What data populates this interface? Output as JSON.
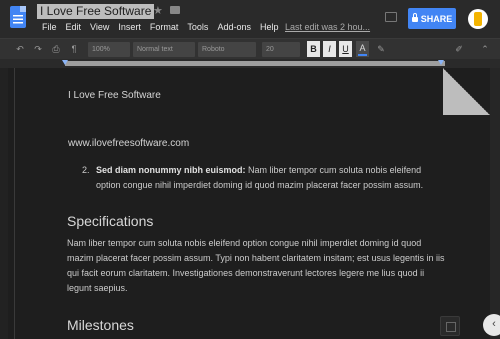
{
  "header": {
    "doc_title": "I Love Free Software",
    "menu": [
      "File",
      "Edit",
      "View",
      "Insert",
      "Format",
      "Tools",
      "Add-ons",
      "Help"
    ],
    "last_edit": "Last edit was 2 hou...",
    "share_label": "SHARE"
  },
  "toolbar": {
    "zoom": "100%",
    "style": "Normal text",
    "font": "Roboto",
    "size": "20",
    "bold": "B",
    "italic": "I",
    "underline": "U",
    "text_color": "A"
  },
  "document": {
    "name_line": "I Love Free Software",
    "url_line": "www.ilovefreesoftware.com",
    "list_number": "2.",
    "list_bold": "Sed diam nonummy nibh euismod:",
    "list_text": " Nam liber tempor cum soluta nobis eleifend option congue nihil imperdiet doming id quod mazim placerat facer possim assum.",
    "heading_1": "Specifications",
    "paragraph_1": "Nam liber tempor cum soluta nobis eleifend option congue nihil imperdiet doming id quod mazim placerat facer possim assum. Typi non habent claritatem insitam; est usus legentis in iis qui facit eorum claritatem. Investigationes demonstraverunt lectores legere me lius quod ii legunt saepius.",
    "heading_2": "Milestones"
  },
  "colors": {
    "background": "#1e1e1e",
    "accent": "#4285f4"
  },
  "icons": [
    "docs-icon",
    "star-icon",
    "folder-icon",
    "comment-icon",
    "lock-icon",
    "avatar",
    "undo-icon",
    "redo-icon",
    "print-icon",
    "paint-format-icon",
    "highlight-icon",
    "edit-mode-icon",
    "collapse-icon",
    "explore-icon",
    "chevron-left-icon"
  ]
}
